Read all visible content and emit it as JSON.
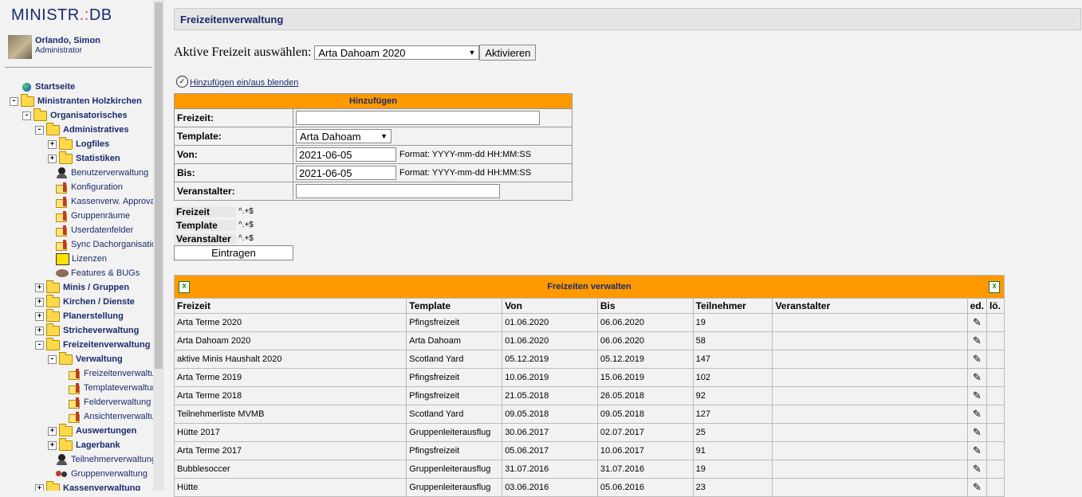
{
  "app": {
    "logo_left": "MINISTR",
    "logo_dot": ".:",
    "logo_right": "DB"
  },
  "user": {
    "name": "Orlando, Simon",
    "role": "Administrator"
  },
  "tree": [
    {
      "label": "Startseite",
      "icon": "globe-icon",
      "bold": true,
      "exp": null,
      "depth": 1
    },
    {
      "label": "Ministranten Holzkirchen",
      "icon": "folder-icon",
      "bold": true,
      "exp": "-",
      "depth": 0
    },
    {
      "label": "Organisatorisches",
      "icon": "folder-icon",
      "bold": true,
      "exp": "-",
      "depth": 1
    },
    {
      "label": "Administratives",
      "icon": "folder-icon",
      "bold": true,
      "exp": "-",
      "depth": 2
    },
    {
      "label": "Logfiles",
      "icon": "folder-icon",
      "bold": true,
      "exp": "+",
      "depth": 3
    },
    {
      "label": "Statistiken",
      "icon": "folder-icon",
      "bold": true,
      "exp": "+",
      "depth": 3
    },
    {
      "label": "Benutzerverwaltung",
      "icon": "person-icon",
      "bold": false,
      "exp": null,
      "depth": 4
    },
    {
      "label": "Konfiguration",
      "icon": "folder-pencil-icon",
      "bold": false,
      "exp": null,
      "depth": 4
    },
    {
      "label": "Kassenverw. Approval",
      "icon": "folder-pencil-icon",
      "bold": false,
      "exp": null,
      "depth": 4
    },
    {
      "label": "Gruppenräume",
      "icon": "folder-pencil-icon",
      "bold": false,
      "exp": null,
      "depth": 4
    },
    {
      "label": "Userdatenfelder",
      "icon": "folder-pencil-icon",
      "bold": false,
      "exp": null,
      "depth": 4
    },
    {
      "label": "Sync Dachorganisation",
      "icon": "folder-pencil-icon",
      "bold": false,
      "exp": null,
      "depth": 4
    },
    {
      "label": "Lizenzen",
      "icon": "license-icon",
      "bold": false,
      "exp": null,
      "depth": 4
    },
    {
      "label": "Features & BUGs",
      "icon": "features-icon",
      "bold": false,
      "exp": null,
      "depth": 4
    },
    {
      "label": "Minis / Gruppen",
      "icon": "folder-icon",
      "bold": true,
      "exp": "+",
      "depth": 2
    },
    {
      "label": "Kirchen / Dienste",
      "icon": "folder-icon",
      "bold": true,
      "exp": "+",
      "depth": 2
    },
    {
      "label": "Planerstellung",
      "icon": "folder-icon",
      "bold": true,
      "exp": "+",
      "depth": 2
    },
    {
      "label": "Stricheverwaltung",
      "icon": "folder-icon",
      "bold": true,
      "exp": "+",
      "depth": 2
    },
    {
      "label": "Freizeitenverwaltung",
      "icon": "folder-icon",
      "bold": true,
      "exp": "-",
      "depth": 2
    },
    {
      "label": "Verwaltung",
      "icon": "folder-icon",
      "bold": true,
      "exp": "-",
      "depth": 3
    },
    {
      "label": "Freizeitenverwaltung",
      "icon": "folder-pencil-icon",
      "bold": false,
      "exp": null,
      "depth": 5
    },
    {
      "label": "Templateverwaltung",
      "icon": "folder-pencil-icon",
      "bold": false,
      "exp": null,
      "depth": 5
    },
    {
      "label": "Felderverwaltung",
      "icon": "folder-pencil-icon",
      "bold": false,
      "exp": null,
      "depth": 5
    },
    {
      "label": "Ansichtenverwaltung",
      "icon": "folder-pencil-icon",
      "bold": false,
      "exp": null,
      "depth": 5
    },
    {
      "label": "Auswertungen",
      "icon": "folder-icon",
      "bold": true,
      "exp": "+",
      "depth": 3
    },
    {
      "label": "Lagerbank",
      "icon": "folder-icon",
      "bold": true,
      "exp": "+",
      "depth": 3
    },
    {
      "label": "Teilnehmerverwaltung",
      "icon": "person-icon",
      "bold": false,
      "exp": null,
      "depth": 4
    },
    {
      "label": "Gruppenverwaltung",
      "icon": "group-icon",
      "bold": false,
      "exp": null,
      "depth": 4
    },
    {
      "label": "Kassenverwaltung",
      "icon": "folder-icon",
      "bold": true,
      "exp": "+",
      "depth": 2
    }
  ],
  "page_title": "Freizeitenverwaltung",
  "active_select": {
    "label": "Aktive Freizeit auswählen:",
    "value": "Arta Dahoam 2020",
    "button": "Aktivieren"
  },
  "toggle_link": "Hinzufügen ein/aus blenden",
  "add_form": {
    "caption": "Hinzufügen",
    "freizeit_label": "Freizeit:",
    "freizeit_value": "",
    "template_label": "Template:",
    "template_value": "Arta Dahoam",
    "von_label": "Von:",
    "von_value": "2021-06-05",
    "von_format": "Format: YYYY-mm-dd HH:MM:SS",
    "bis_label": "Bis:",
    "bis_value": "2021-06-05",
    "bis_format": "Format: YYYY-mm-dd HH:MM:SS",
    "veranstalter_label": "Veranstalter:",
    "veranstalter_value": ""
  },
  "rules": [
    {
      "field": "Freizeit",
      "pattern": "^.+$"
    },
    {
      "field": "Template",
      "pattern": "^.+$"
    },
    {
      "field": "Veranstalter",
      "pattern": "^.+$"
    }
  ],
  "submit_label": "Eintragen",
  "list": {
    "caption": "Freizeiten verwalten",
    "export_icon": "excel-icon",
    "headers": [
      "Freizeit",
      "Template",
      "Von",
      "Bis",
      "Teilnehmer",
      "Veranstalter",
      "ed.",
      "lö."
    ],
    "rows": [
      [
        "Arta Terme 2020",
        "Pfingsfreizeit",
        "01.06.2020",
        "06.06.2020",
        "19",
        ""
      ],
      [
        "Arta Dahoam 2020",
        "Arta Dahoam",
        "01.06.2020",
        "06.06.2020",
        "58",
        ""
      ],
      [
        "aktive Minis Haushalt 2020",
        "Scotland Yard",
        "05.12.2019",
        "05.12.2019",
        "147",
        ""
      ],
      [
        "Arta Terme 2019",
        "Pfingsfreizeit",
        "10.06.2019",
        "15.06.2019",
        "102",
        ""
      ],
      [
        "Arta Terme 2018",
        "Pfingsfreizeit",
        "21.05.2018",
        "26.05.2018",
        "92",
        ""
      ],
      [
        "Teilnehmerliste MVMB",
        "Scotland Yard",
        "09.05.2018",
        "09.05.2018",
        "127",
        ""
      ],
      [
        "Hütte 2017",
        "Gruppenleiterausflug",
        "30.06.2017",
        "02.07.2017",
        "25",
        ""
      ],
      [
        "Arta Terme 2017",
        "Pfingsfreizeit",
        "05.06.2017",
        "10.06.2017",
        "91",
        ""
      ],
      [
        "Bubblesoccer",
        "Gruppenleiterausflug",
        "31.07.2016",
        "31.07.2016",
        "19",
        ""
      ],
      [
        "Hütte",
        "Gruppenleiterausflug",
        "03.06.2016",
        "05.06.2016",
        "23",
        ""
      ]
    ]
  },
  "colors": {
    "accent": "#ff9900",
    "link": "#1a2b6d"
  }
}
